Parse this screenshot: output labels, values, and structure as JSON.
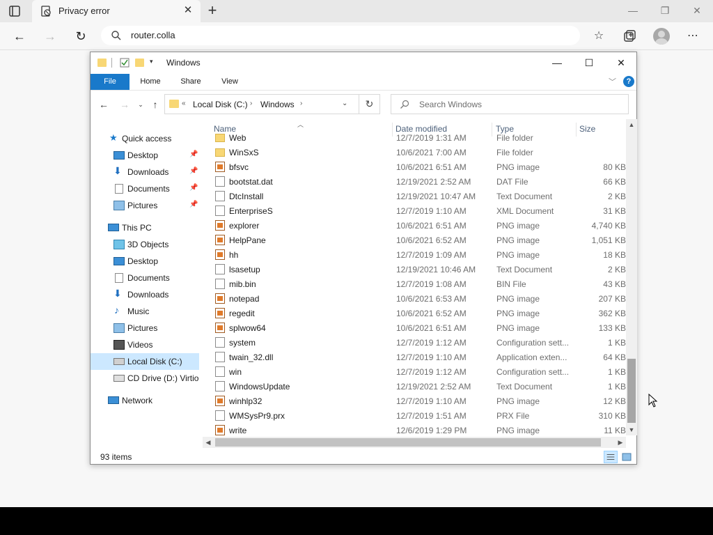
{
  "browser": {
    "tab_title": "Privacy error",
    "address": "router.colla"
  },
  "explorer": {
    "title": "Windows",
    "ribbon_tabs": [
      "File",
      "Home",
      "Share",
      "View"
    ],
    "breadcrumb": [
      "Local Disk (C:)",
      "Windows"
    ],
    "search_placeholder": "Search Windows",
    "columns": {
      "name": "Name",
      "date": "Date modified",
      "type": "Type",
      "size": "Size"
    },
    "status": "93 items"
  },
  "navpane": {
    "quick_access": "Quick access",
    "quick_items": [
      "Desktop",
      "Downloads",
      "Documents",
      "Pictures"
    ],
    "this_pc": "This PC",
    "pc_items": [
      "3D Objects",
      "Desktop",
      "Documents",
      "Downloads",
      "Music",
      "Pictures",
      "Videos",
      "Local Disk (C:)",
      "CD Drive (D:) Virtio"
    ],
    "network": "Network"
  },
  "files": [
    {
      "name": "Web",
      "date": "12/7/2019 1:31 AM",
      "type": "File folder",
      "size": "",
      "icon": "folder"
    },
    {
      "name": "WinSxS",
      "date": "10/6/2021 7:00 AM",
      "type": "File folder",
      "size": "",
      "icon": "folder"
    },
    {
      "name": "bfsvc",
      "date": "10/6/2021 6:51 AM",
      "type": "PNG image",
      "size": "80 KB",
      "icon": "image"
    },
    {
      "name": "bootstat.dat",
      "date": "12/19/2021 2:52 AM",
      "type": "DAT File",
      "size": "66 KB",
      "icon": "file"
    },
    {
      "name": "DtcInstall",
      "date": "12/19/2021 10:47 AM",
      "type": "Text Document",
      "size": "2 KB",
      "icon": "text"
    },
    {
      "name": "EnterpriseS",
      "date": "12/7/2019 1:10 AM",
      "type": "XML Document",
      "size": "31 KB",
      "icon": "xml"
    },
    {
      "name": "explorer",
      "date": "10/6/2021 6:51 AM",
      "type": "PNG image",
      "size": "4,740 KB",
      "icon": "image"
    },
    {
      "name": "HelpPane",
      "date": "10/6/2021 6:52 AM",
      "type": "PNG image",
      "size": "1,051 KB",
      "icon": "image"
    },
    {
      "name": "hh",
      "date": "12/7/2019 1:09 AM",
      "type": "PNG image",
      "size": "18 KB",
      "icon": "image"
    },
    {
      "name": "lsasetup",
      "date": "12/19/2021 10:46 AM",
      "type": "Text Document",
      "size": "2 KB",
      "icon": "text"
    },
    {
      "name": "mib.bin",
      "date": "12/7/2019 1:08 AM",
      "type": "BIN File",
      "size": "43 KB",
      "icon": "file"
    },
    {
      "name": "notepad",
      "date": "10/6/2021 6:53 AM",
      "type": "PNG image",
      "size": "207 KB",
      "icon": "image"
    },
    {
      "name": "regedit",
      "date": "10/6/2021 6:52 AM",
      "type": "PNG image",
      "size": "362 KB",
      "icon": "image"
    },
    {
      "name": "splwow64",
      "date": "10/6/2021 6:51 AM",
      "type": "PNG image",
      "size": "133 KB",
      "icon": "image"
    },
    {
      "name": "system",
      "date": "12/7/2019 1:12 AM",
      "type": "Configuration sett...",
      "size": "1 KB",
      "icon": "config"
    },
    {
      "name": "twain_32.dll",
      "date": "12/7/2019 1:10 AM",
      "type": "Application exten...",
      "size": "64 KB",
      "icon": "config"
    },
    {
      "name": "win",
      "date": "12/7/2019 1:12 AM",
      "type": "Configuration sett...",
      "size": "1 KB",
      "icon": "config"
    },
    {
      "name": "WindowsUpdate",
      "date": "12/19/2021 2:52 AM",
      "type": "Text Document",
      "size": "1 KB",
      "icon": "text"
    },
    {
      "name": "winhlp32",
      "date": "12/7/2019 1:10 AM",
      "type": "PNG image",
      "size": "12 KB",
      "icon": "image"
    },
    {
      "name": "WMSysPr9.prx",
      "date": "12/7/2019 1:51 AM",
      "type": "PRX File",
      "size": "310 KB",
      "icon": "file"
    },
    {
      "name": "write",
      "date": "12/6/2019 1:29 PM",
      "type": "PNG image",
      "size": "11 KB",
      "icon": "image"
    }
  ]
}
